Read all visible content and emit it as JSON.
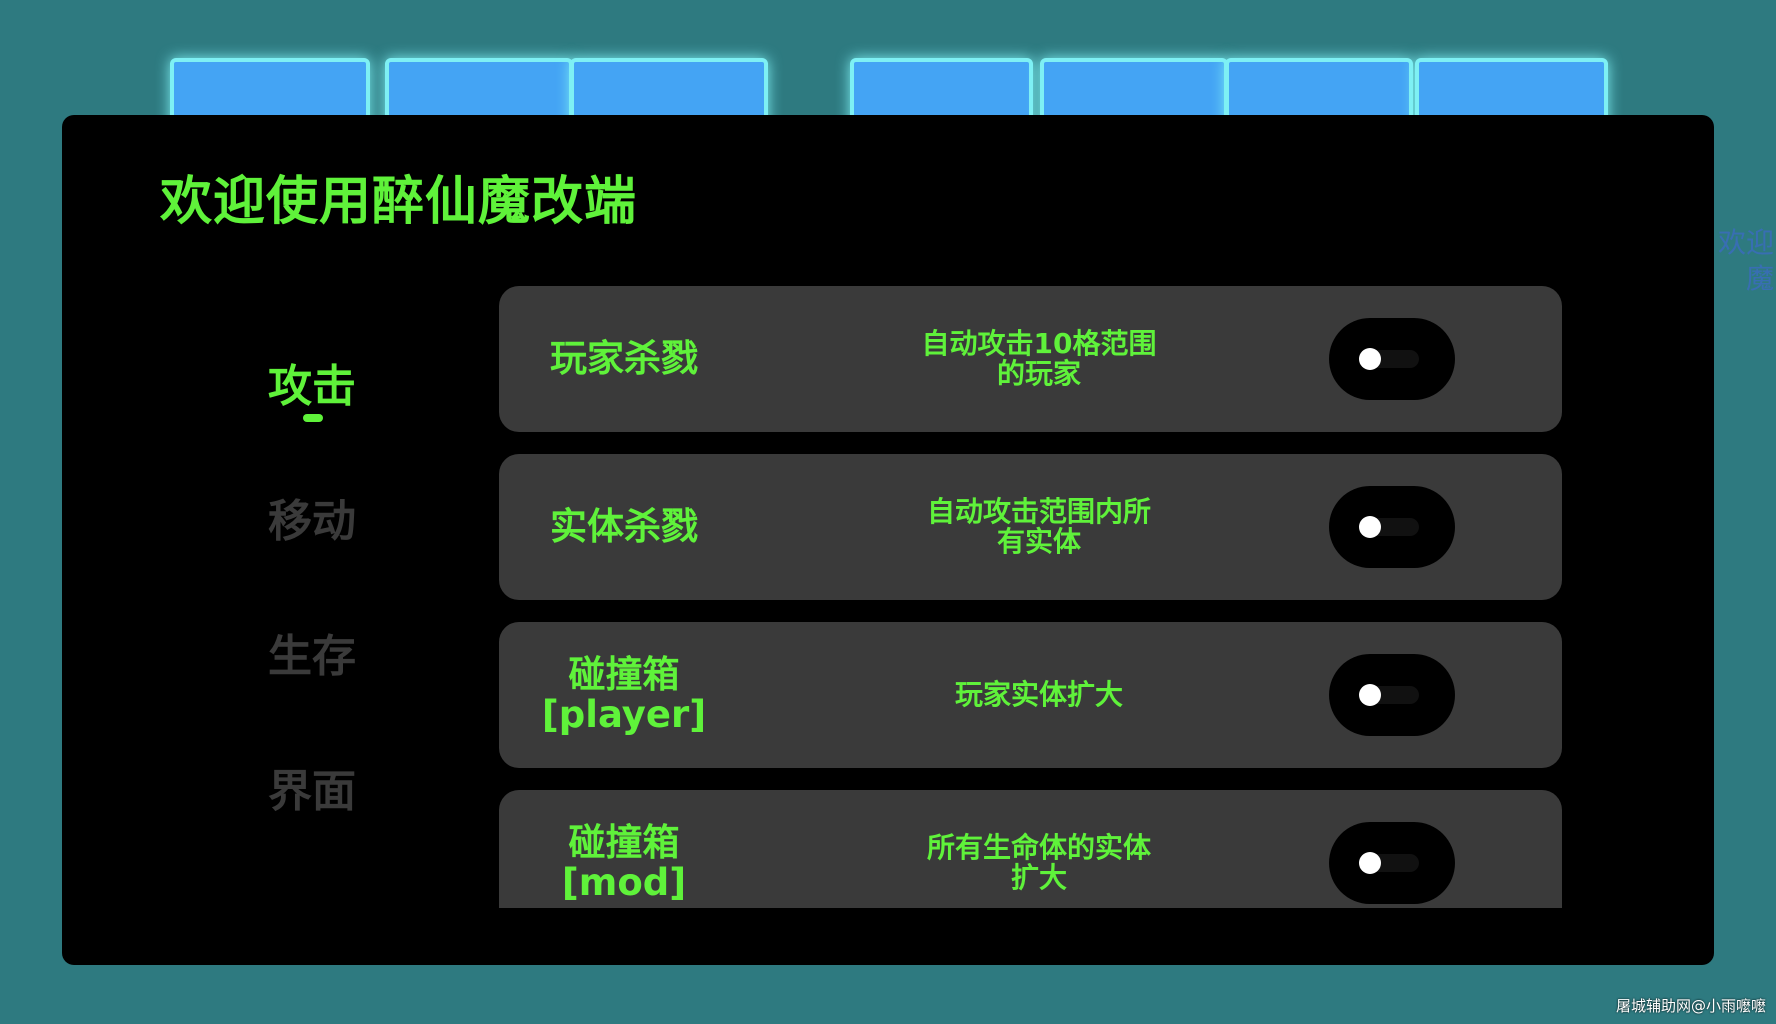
{
  "panel": {
    "title": "欢迎使用醉仙魔改端"
  },
  "nav": {
    "items": [
      {
        "label": "攻击",
        "active": true
      },
      {
        "label": "移动",
        "active": false
      },
      {
        "label": "生存",
        "active": false
      },
      {
        "label": "界面",
        "active": false
      }
    ]
  },
  "features": [
    {
      "name": "玩家杀戮",
      "description": "自动攻击10格范围的玩家",
      "enabled": false
    },
    {
      "name": "实体杀戮",
      "description": "自动攻击范围内所有实体",
      "enabled": false
    },
    {
      "name": "碰撞箱\n[player]",
      "description": "玩家实体扩大",
      "enabled": false
    },
    {
      "name": "碰撞箱\n[mod]",
      "description": "所有生命体的实体扩大",
      "enabled": false
    }
  ],
  "background": {
    "edge_text": "欢迎\n魔",
    "watermark": "屠城辅助网@小雨嚒嚒"
  },
  "colors": {
    "accent": "#5ff23a",
    "panel_bg": "#000000",
    "row_bg": "#3a3a3a",
    "inactive_nav": "#3a3a3a",
    "page_bg": "#2e7a80",
    "logo_block": "#44a4f4",
    "logo_glow": "#7ef0f4"
  }
}
